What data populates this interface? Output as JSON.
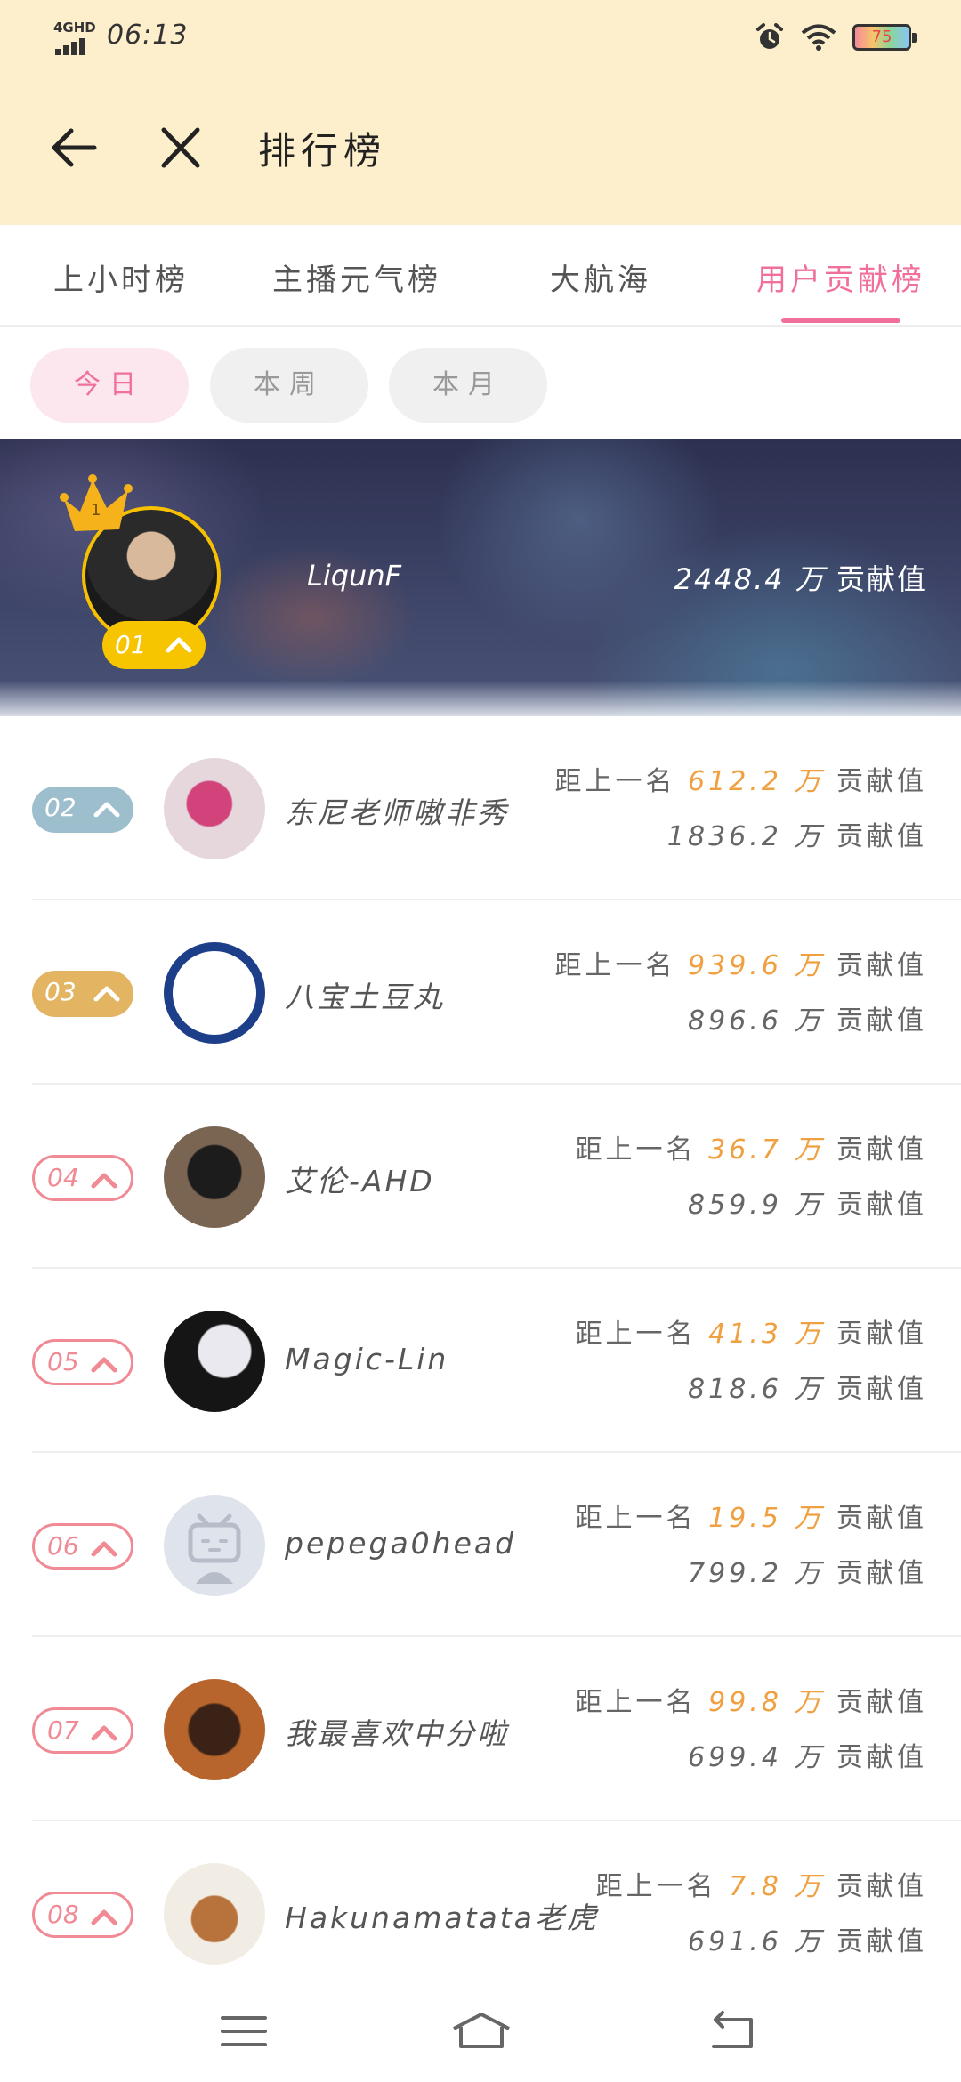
{
  "status_bar": {
    "network": "4GHD",
    "time": "06:13",
    "battery": "75"
  },
  "appbar": {
    "title": "排行榜"
  },
  "tabs": [
    {
      "label": "上小时榜",
      "active": false
    },
    {
      "label": "主播元气榜",
      "active": false
    },
    {
      "label": "大航海",
      "active": false
    },
    {
      "label": "用户贡献榜",
      "active": true
    }
  ],
  "filters": [
    {
      "label": "今日",
      "active": true
    },
    {
      "label": "本周",
      "active": false
    },
    {
      "label": "本月",
      "active": false
    }
  ],
  "top1": {
    "rank": "01",
    "name": "LiqunF",
    "score": "2448.4",
    "unit": "万",
    "label": "贡献值"
  },
  "gap_prefix": "距上一名",
  "unit": "万",
  "label": "贡献值",
  "rows": [
    {
      "rank": "02",
      "name": "东尼老师嗷非秀",
      "gap": "612.2",
      "total": "1836.2"
    },
    {
      "rank": "03",
      "name": "八宝土豆丸",
      "gap": "939.6",
      "total": "896.6"
    },
    {
      "rank": "04",
      "name": "艾伦-AHD",
      "gap": "36.7",
      "total": "859.9"
    },
    {
      "rank": "05",
      "name": "Magic-Lin",
      "gap": "41.3",
      "total": "818.6"
    },
    {
      "rank": "06",
      "name": "pepega0head",
      "gap": "19.5",
      "total": "799.2"
    },
    {
      "rank": "07",
      "name": "我最喜欢中分啦",
      "gap": "99.8",
      "total": "699.4"
    },
    {
      "rank": "08",
      "name": "Hakunamatata老虎",
      "gap": "7.8",
      "total": "691.6"
    }
  ],
  "colors": {
    "accent_pink": "#f0709a",
    "header_bg": "#fdefcb",
    "gold": "#f6c500",
    "highlight_orange": "#f0a040"
  },
  "icons": [
    "back-arrow-icon",
    "close-icon",
    "crown-icon",
    "rank-up-icon",
    "menu-icon",
    "home-icon",
    "return-icon",
    "alarm-icon",
    "wifi-icon",
    "battery-icon"
  ]
}
